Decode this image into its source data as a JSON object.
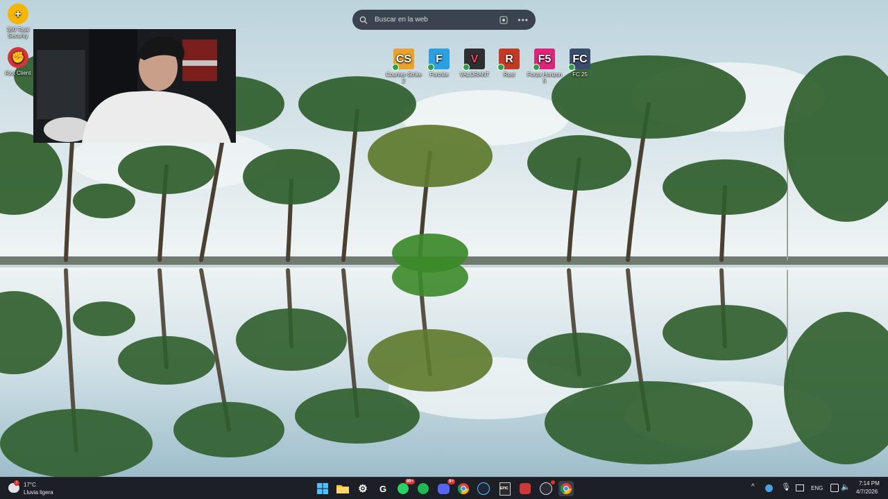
{
  "search": {
    "placeholder": "Buscar en la web"
  },
  "desktop_left": [
    {
      "label": "360 Total Security",
      "icon": "360-total-security-icon",
      "color": "#f6b500"
    },
    {
      "label": "Riot Client",
      "icon": "riot-client-icon",
      "color": "#d13639"
    }
  ],
  "desktop_top": [
    {
      "label": "Counter-Strike 2",
      "icon": "counter-strike-2-icon",
      "color": "#e9a22a"
    },
    {
      "label": "Fortnite",
      "icon": "fortnite-icon",
      "color": "#2b9fe0"
    },
    {
      "label": "VALORANT",
      "icon": "valorant-icon",
      "color": "#2e2f33"
    },
    {
      "label": "Rust",
      "icon": "rust-icon",
      "color": "#c23a25"
    },
    {
      "label": "Forza Horizon 5",
      "icon": "forza-horizon-5-icon",
      "color": "#e0237a"
    },
    {
      "label": "FC 25",
      "icon": "fc-25-icon",
      "color": "#3a4b6b"
    }
  ],
  "weather": {
    "temp": "17°C",
    "desc": "Lluvia ligera",
    "alert": "!"
  },
  "taskbar": {
    "apps": [
      {
        "name": "start-button",
        "icon": "windows-logo-icon"
      },
      {
        "name": "file-explorer",
        "icon": "folder-icon",
        "color": "#f6c244"
      },
      {
        "name": "settings",
        "icon": "gear-icon",
        "color": "#2a2d33"
      },
      {
        "name": "opera-gx",
        "icon": "opera-gx-icon",
        "color": "#2a2d33"
      },
      {
        "name": "whatsapp",
        "icon": "whatsapp-icon",
        "color": "#25d366",
        "badge": "99+"
      },
      {
        "name": "spotify",
        "icon": "spotify-icon",
        "color": "#1db954"
      },
      {
        "name": "discord",
        "icon": "discord-icon",
        "color": "#5865f2",
        "badge": "9+"
      },
      {
        "name": "chrome",
        "icon": "chrome-icon",
        "color": "#ffffff"
      },
      {
        "name": "steam",
        "icon": "steam-icon",
        "color": "#1b2838"
      },
      {
        "name": "epic-games",
        "icon": "epic-games-icon",
        "color": "#2a2a2a"
      },
      {
        "name": "riot-client",
        "icon": "riot-client-icon",
        "color": "#d13639"
      },
      {
        "name": "obs",
        "icon": "obs-icon",
        "color": "#2a2d33"
      },
      {
        "name": "chrome-active",
        "icon": "chrome-icon",
        "color": "#ffffff"
      }
    ],
    "lang": "ENG",
    "time": "7:14 PM",
    "date": "4/7/2026"
  }
}
